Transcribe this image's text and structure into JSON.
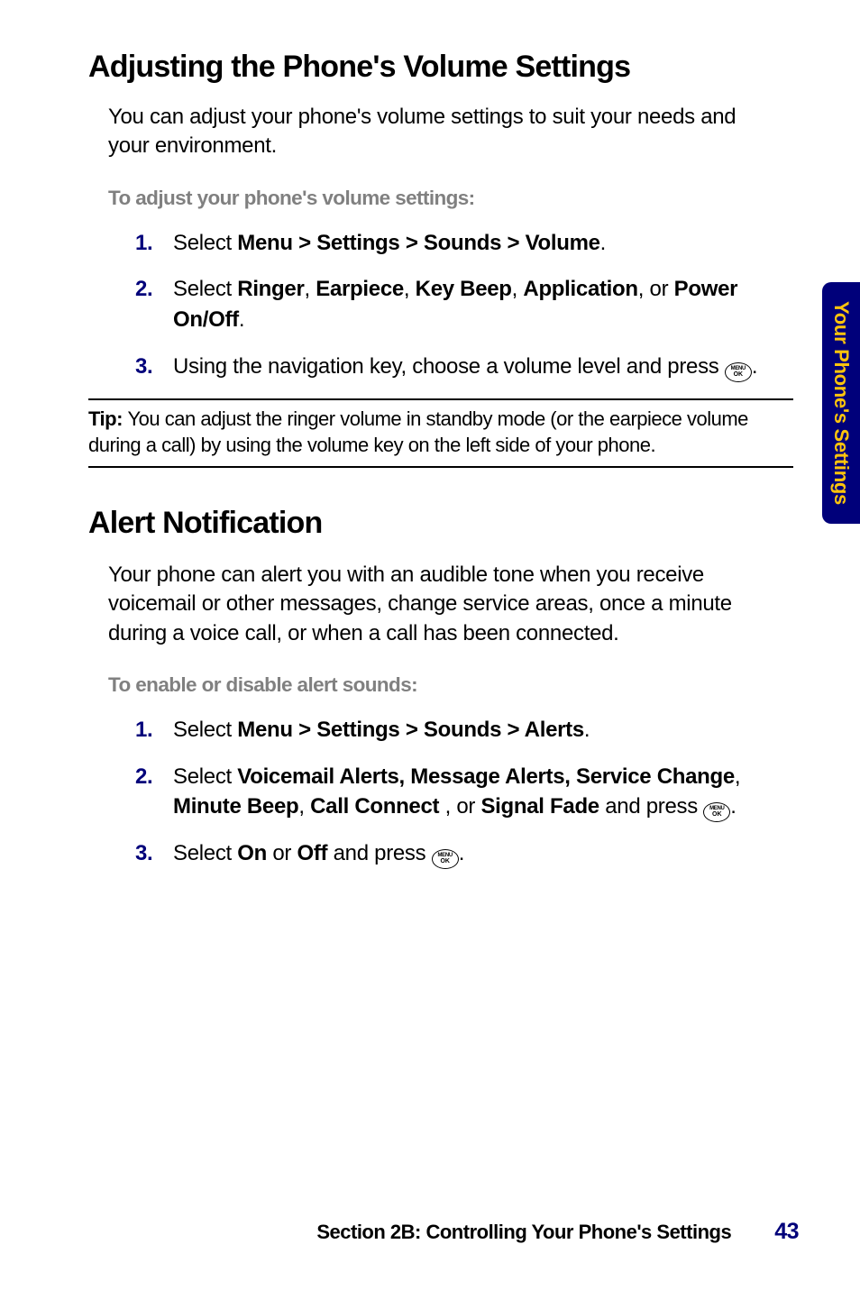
{
  "sideTab": {
    "label": "Your Phone's Settings"
  },
  "section1": {
    "heading": "Adjusting the Phone's Volume Settings",
    "intro": "You can adjust your phone's volume settings to suit your needs and your environment.",
    "subhead": "To adjust your phone's volume settings:",
    "steps": {
      "1": {
        "marker": "1.",
        "pre": "Select ",
        "bold": "Menu > Settings > Sounds > Volume",
        "post": "."
      },
      "2": {
        "marker": "2.",
        "pre": "Select ",
        "b1": "Ringer",
        "c1": ", ",
        "b2": "Earpiece",
        "c2": ", ",
        "b3": "Key Beep",
        "c3": ", ",
        "b4": "Application",
        "c4": ", or ",
        "b5": "Power On/Off",
        "post": "."
      },
      "3": {
        "marker": "3.",
        "pre": "Using the navigation key, choose a volume level and press ",
        "post": "."
      }
    }
  },
  "tip": {
    "label": "Tip: ",
    "text": "You can adjust the ringer volume in standby mode (or the earpiece volume during a call) by using the volume key on the left side of your phone."
  },
  "section2": {
    "heading": "Alert Notification",
    "intro": "Your phone can alert you with an audible tone when you receive voicemail or other messages, change service areas, once a minute during a voice call, or when a call has been connected.",
    "subhead": "To enable or disable alert sounds:",
    "steps": {
      "1": {
        "marker": "1.",
        "pre": "Select ",
        "bold": "Menu > Settings > Sounds > Alerts",
        "post": "."
      },
      "2": {
        "marker": "2.",
        "pre": "Select ",
        "b1": "Voicemail Alerts, Message Alerts, Service Change",
        "c1": ", ",
        "b2": "Minute Beep",
        "c2": ", ",
        "b3": "Call Connect",
        "c3": " , or ",
        "b4": "Signal Fade",
        "mid": " and press ",
        "post": "."
      },
      "3": {
        "marker": "3.",
        "pre": "Select ",
        "b1": "On",
        "c1": " or ",
        "b2": "Off",
        "mid": " and press ",
        "post": "."
      }
    }
  },
  "footer": {
    "text": "Section 2B: Controlling Your Phone's Settings",
    "page": "43"
  },
  "icons": {
    "menuOk": "MENU/OK"
  }
}
